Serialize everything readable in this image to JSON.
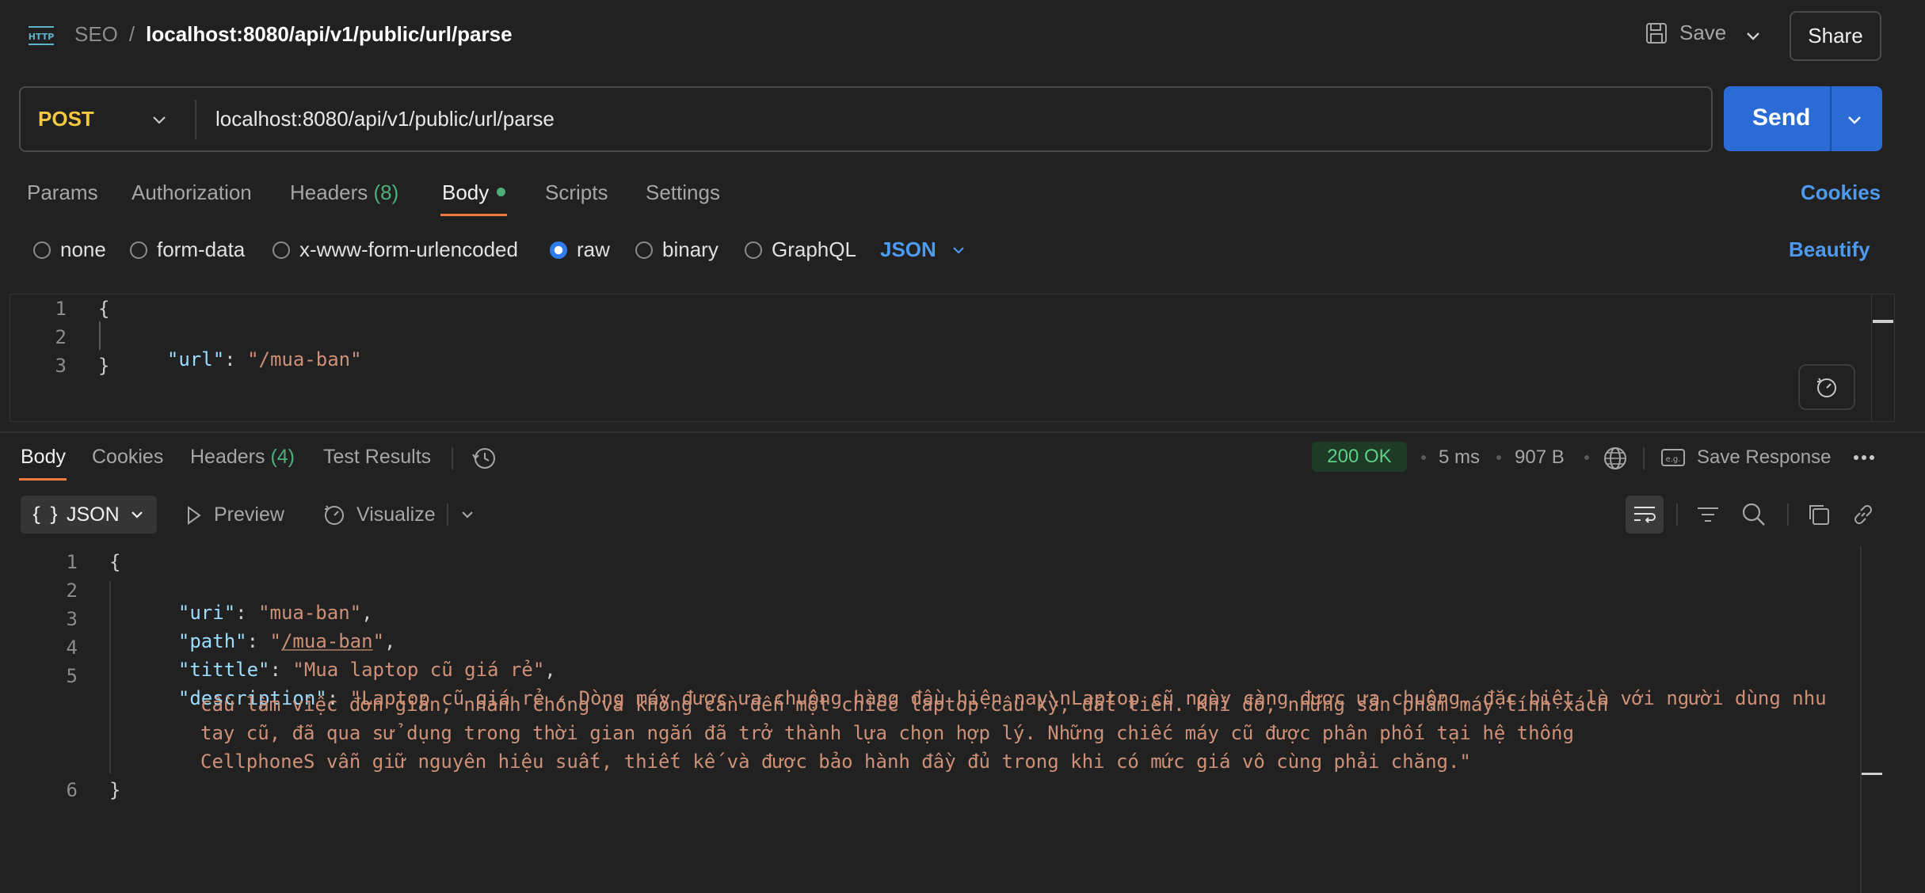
{
  "header": {
    "protocol_icon": "http-icon",
    "collection": "SEO",
    "separator": "/",
    "request_name": "localhost:8080/api/v1/public/url/parse",
    "save_label": "Save",
    "share_label": "Share"
  },
  "request": {
    "method": "POST",
    "url": "localhost:8080/api/v1/public/url/parse",
    "send_label": "Send"
  },
  "request_tabs": {
    "params": "Params",
    "authorization": "Authorization",
    "headers": "Headers",
    "headers_count": "(8)",
    "body": "Body",
    "scripts": "Scripts",
    "settings": "Settings",
    "cookies": "Cookies"
  },
  "body_types": {
    "none": "none",
    "form_data": "form-data",
    "urlencoded": "x-www-form-urlencoded",
    "raw": "raw",
    "binary": "binary",
    "graphql": "GraphQL",
    "selected": "raw",
    "language": "JSON",
    "beautify": "Beautify"
  },
  "request_body": {
    "line_numbers": [
      "1",
      "2",
      "3"
    ],
    "open": "{",
    "key": "\"url\"",
    "colon": ": ",
    "value": "\"/mua-ban\"",
    "close": "}"
  },
  "response_tabs": {
    "body": "Body",
    "cookies": "Cookies",
    "headers": "Headers",
    "headers_count": "(4)",
    "test_results": "Test Results"
  },
  "response_meta": {
    "status": "200 OK",
    "time": "5 ms",
    "size": "907 B",
    "save_response": "Save Response",
    "status_color": "#5fcf86"
  },
  "response_toolbar": {
    "format": "JSON",
    "preview": "Preview",
    "visualize": "Visualize"
  },
  "response_body": {
    "line_numbers": [
      "1",
      "2",
      "3",
      "4",
      "5",
      "6"
    ],
    "open": "{",
    "uri_key": "\"uri\"",
    "uri_value": "\"mua-ban\"",
    "path_key": "\"path\"",
    "path_value_q1": "\"",
    "path_value": "/mua-ban",
    "path_value_q2": "\"",
    "tittle_key": "\"tittle\"",
    "tittle_value": "\"Mua laptop cũ giá rẻ\"",
    "description_key": "\"description\"",
    "description_line1": "\"Laptop cũ giá rẻ - Dòng máy được ưa chuộng hàng đầu hiện nay\\nLaptop cũ ngày càng được ưa chuộng, đặc biệt là với người dùng nhu",
    "description_line2": "cầu làm việc đơn giản, nhanh chóng và không cần đến một chiếc laptop cầu kỳ, đắt tiền. Khi đó, những sản phẩm máy tính xách",
    "description_line3": "tay cũ, đã qua sử dụng trong thời gian ngắn đã trở thành lựa chọn hợp lý. Những chiếc máy cũ được phân phối tại hệ thống",
    "description_line4": "CellphoneS vẫn giữ nguyên hiệu suất, thiết kế và được bảo hành đầy đủ trong khi có mức giá vô cùng phải chăng.\"",
    "close": "}"
  },
  "colors": {
    "accent_blue": "#2a6bd6",
    "method_yellow": "#f5c842",
    "tab_underline": "#f07a3e",
    "json_key": "#9cdcfe",
    "json_string": "#ce9178"
  }
}
